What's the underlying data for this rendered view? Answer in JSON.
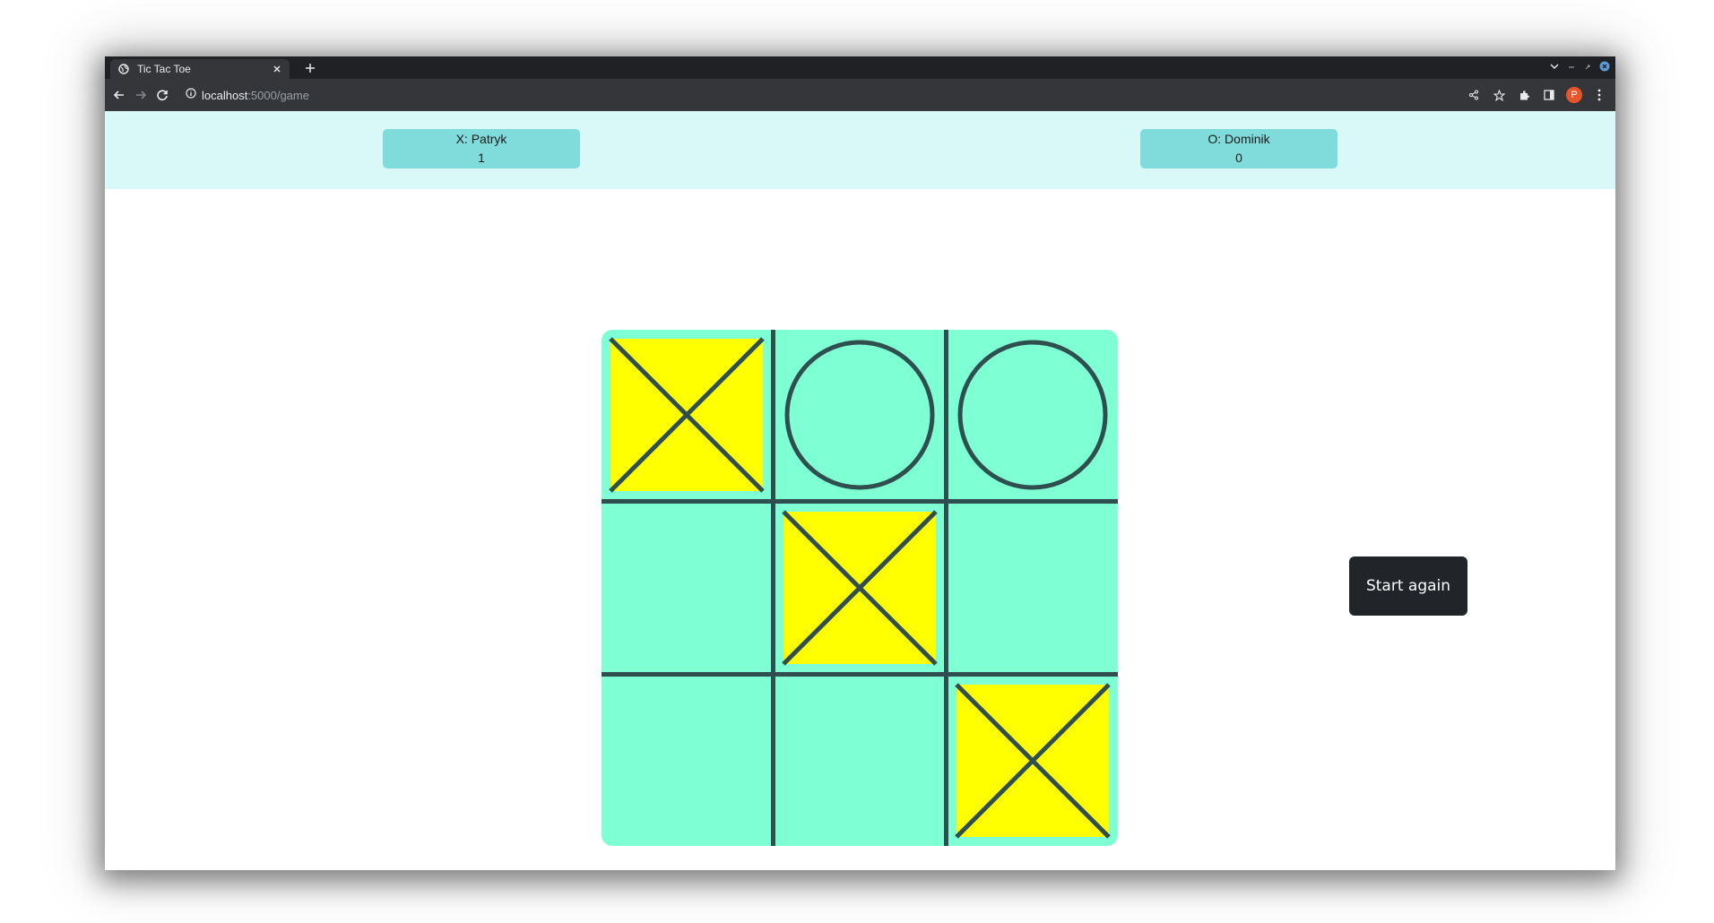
{
  "browser": {
    "tab_title": "Tic Tac Toe",
    "url_host": "localhost",
    "url_path": ":5000/game",
    "profile_initial": "P"
  },
  "scoreboard": {
    "x_label": "X: Patryk",
    "x_score": "1",
    "o_label": "O: Dominik",
    "o_score": "0"
  },
  "board": {
    "cells": [
      "X",
      "O",
      "O",
      "",
      "X",
      "",
      "",
      "",
      "X"
    ],
    "highlight_color": "#ffff00",
    "board_color": "#7fffd4",
    "line_color": "#2f4f4f"
  },
  "controls": {
    "start_again_label": "Start again"
  },
  "colors": {
    "scorebar_bg": "#d9f8f8",
    "scorecard_bg": "#80dbdb",
    "button_bg": "#212529"
  }
}
